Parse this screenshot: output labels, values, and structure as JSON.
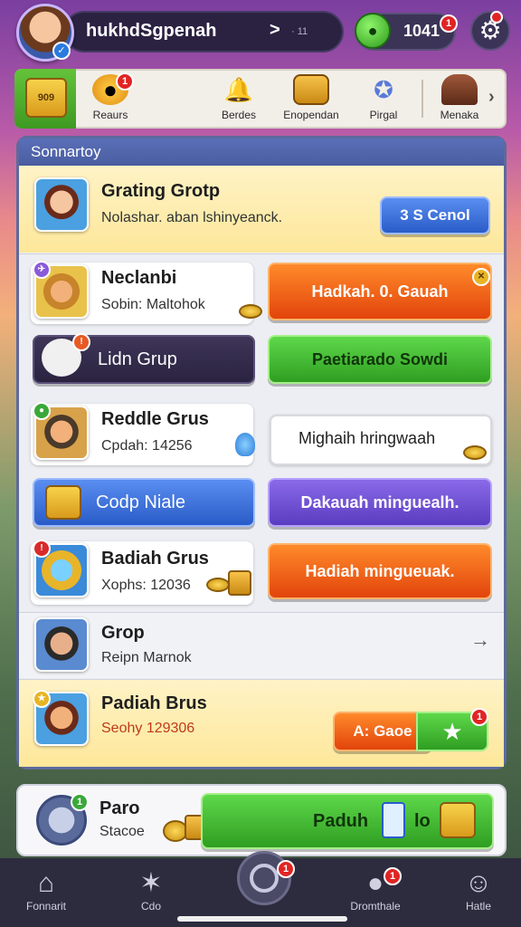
{
  "header": {
    "username": "hukhdSgpenah",
    "arrow": ">",
    "small_text": "· 11",
    "coins": "1041",
    "coin_badge": "1"
  },
  "shortcuts": {
    "first_icon_text": "909",
    "items": [
      {
        "label": "Reaurs",
        "badge": "1",
        "icon": "coin-icon"
      },
      {
        "label": "Berdes",
        "icon": "bell-icon"
      },
      {
        "label": "Enopendan",
        "icon": "chest-icon"
      },
      {
        "label": "Pirgal",
        "icon": "gift-icon"
      },
      {
        "label": "Menaka",
        "icon": "shop-icon"
      }
    ]
  },
  "panel": {
    "title": "Sonnartoy",
    "top_row": {
      "title": "Grating Grotp",
      "sub": "Nolashar. aban lshinyeanck.",
      "button": "3 S Cenol"
    },
    "rows": [
      {
        "title": "Neclanbi",
        "sub": "Sobin: Maltohok",
        "button": "Hadkah. 0. Gauah"
      },
      {
        "title": "Lidn Grup",
        "button": "Paetiarado Sowdi"
      },
      {
        "title": "Reddle Grus",
        "sub": "Cpdah: 14256",
        "button": "Mighaih hringwaah"
      },
      {
        "title": "Codp Niale",
        "button": "Dakauah minguealh."
      },
      {
        "title": "Badiah Grus",
        "sub": "Xophs: 12036",
        "button": "Hadiah mingueuak."
      },
      {
        "title": "Grop",
        "sub": "Reipn Marnok",
        "chevron": "→"
      },
      {
        "title": "Padiah Brus",
        "sub": "Seohy 129306",
        "button": "A: Gaoe",
        "badge": "1"
      }
    ]
  },
  "bottom_card": {
    "title": "Paro",
    "sub": "Stacoe",
    "badge": "1",
    "button": "Paduh",
    "button_suffix": "lo"
  },
  "nav": {
    "items": [
      {
        "label": "Fonnarit",
        "icon": "home-icon"
      },
      {
        "label": "Cdo",
        "icon": "star-icon"
      },
      {
        "label": "Dromthale",
        "icon": "chat-icon",
        "badge": "1"
      },
      {
        "label": "Hatle",
        "icon": "profile-icon"
      }
    ],
    "center_badge": "1"
  }
}
